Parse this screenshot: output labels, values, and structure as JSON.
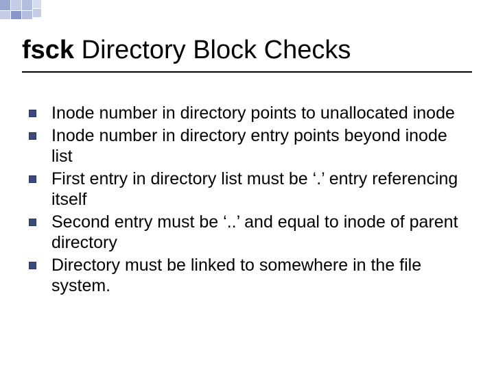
{
  "title": {
    "bold": "fsck",
    "rest": " Directory Block Checks"
  },
  "bullets": [
    "Inode number in directory points to unallocated inode",
    "Inode number in directory entry points beyond inode list",
    "First entry in directory list must be ‘.’ entry referencing itself",
    "Second entry must be ‘..’ and equal to inode of parent directory",
    "Directory must be linked to somewhere in the file system."
  ]
}
